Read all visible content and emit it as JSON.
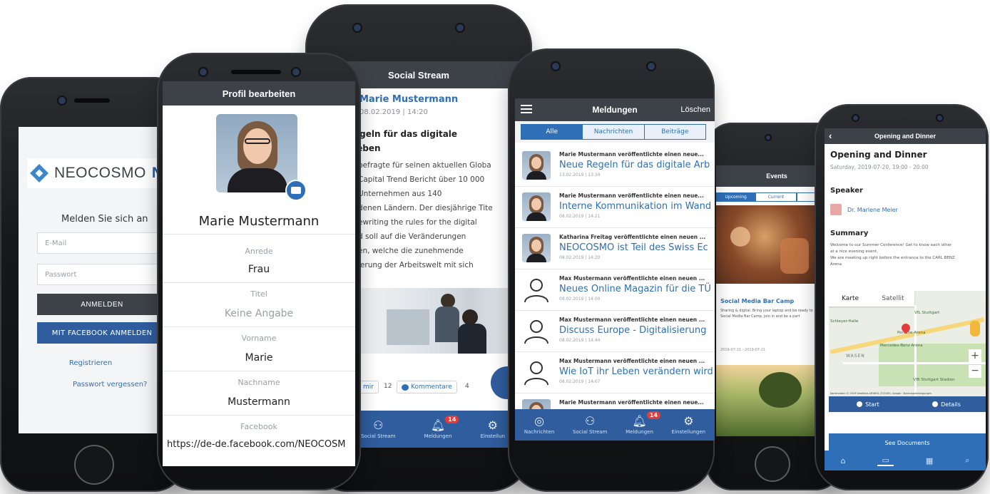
{
  "login": {
    "brand": "NEOCOSMO",
    "brand_cut": "N",
    "heading": "Melden Sie sich an",
    "email_placeholder": "E-Mail",
    "password_placeholder": "Passwort",
    "login_button": "ANMELDEN",
    "facebook_button": "MIT FACEBOOK ANMELDEN",
    "register_link": "Registrieren",
    "forgot_link": "Passwort vergessen?"
  },
  "profile": {
    "title": "Profil bearbeiten",
    "name": "Marie Mustermann",
    "fields": [
      {
        "label": "Anrede",
        "value": "Frau",
        "placeholder": false
      },
      {
        "label": "Titel",
        "value": "Keine Angabe",
        "placeholder": true
      },
      {
        "label": "Vorname",
        "value": "Marie",
        "placeholder": false
      },
      {
        "label": "Nachname",
        "value": "Mustermann",
        "placeholder": false
      },
      {
        "label": "Facebook",
        "value": "https://de-de.facebook.com/NEOCOSM",
        "placeholder": false
      }
    ]
  },
  "stream": {
    "title": "Social Stream",
    "author": "Marie Mustermann",
    "date": "08.02.2019 | 14:20",
    "headline_1": "egeln für das digitale",
    "headline_2": "leben",
    "body": [
      "befragte für seinen aktuellen Globa",
      "Capital Trend Bericht über 10 000",
      "Unternehmen aus 140",
      "denen Ländern. Der diesjährige Tite",
      "ewriting the rules for the digital",
      "d soll auf die Veränderungen",
      "en, welche die zunehmende",
      "ierung der Arbeitswelt mit sich"
    ],
    "like_label": "mir",
    "like_count": "12",
    "comment_label": "Kommentare",
    "comment_count": "4",
    "tabs": [
      {
        "label": "Social Stream",
        "icon": "people-icon"
      },
      {
        "label": "Meldungen",
        "icon": "bell-icon",
        "badge": "14"
      },
      {
        "label": "Einstellun",
        "icon": "gear-icon"
      }
    ]
  },
  "news": {
    "title": "Meldungen",
    "delete_label": "Löschen",
    "filters": [
      {
        "label": "Alle",
        "active": true
      },
      {
        "label": "Nachrichten",
        "active": false
      },
      {
        "label": "Beiträge",
        "active": false
      }
    ],
    "items": [
      {
        "meta": "Marie Mustermann veröffentlichte einen neue...",
        "title": "Neue Regeln für das digitale Arb",
        "date": "13.02.2019 | 13:34",
        "photo": true
      },
      {
        "meta": "Marie Mustermann veröffentlichte einen neue...",
        "title": "Interne Kommunikation im Wand",
        "date": "08.02.2019 | 14:21",
        "photo": true
      },
      {
        "meta": "Katharina Freitag veröffentlichte einen neuen ...",
        "title": "NEOCOSMO ist Teil des Swiss Ec",
        "date": "08.02.2019 | 14:20",
        "photo": true
      },
      {
        "meta": "Max Mustermann veröffentlichte einen neuen ...",
        "title": "Neues Online Magazin für die TÜ",
        "date": "08.02.2019 | 14:00",
        "photo": false
      },
      {
        "meta": "Max Mustermann veröffentlichte einen neuen ...",
        "title": "Discuss Europe - Digitalisierung",
        "date": "08.02.2019 | 14:44",
        "photo": false
      },
      {
        "meta": "Max Mustermann veröffentlichte einen neuen ...",
        "title": "Wie IoT ihr Leben verändern wird",
        "date": "08.02.2019 | 14:07",
        "photo": false
      },
      {
        "meta": "Marie Mustermann veröffentlichte einen neue...",
        "title": "",
        "date": "",
        "photo": true
      }
    ],
    "tabs": [
      {
        "label": "Nachrichten",
        "icon": "globe-icon"
      },
      {
        "label": "Social Stream",
        "icon": "people-icon"
      },
      {
        "label": "Meldungen",
        "icon": "bell-icon",
        "badge": "14"
      },
      {
        "label": "Einstellungen",
        "icon": "gear-icon"
      }
    ]
  },
  "events": {
    "title": "Events",
    "tabs": [
      "Upcoming",
      "Current",
      "La"
    ],
    "card_title": "Social Media Bar Camp",
    "card_text_1": "Sharing & digital. Bring your laptop and be ready to",
    "card_text_2": "Social Media Bar Camp, join in and be a part",
    "card_date": "2019-07-21 - 2019-07-21"
  },
  "detail": {
    "bar_title": "Opening and Dinner",
    "title": "Opening and Dinner",
    "datetime": "Saturday, 2019-07-20, 19:00 - 20:00",
    "speaker_heading": "Speaker",
    "speaker_name": "Dr. Marlene Meier",
    "summary_heading": "Summary",
    "summary_1": "Welcome to our Summer Conference! Get to know each other",
    "summary_2": "at a nice evening event.",
    "summary_3": "We are meeting up right before the entrance to the CARL BENZ",
    "summary_4": "Arena",
    "map_tab_1": "Karte",
    "map_tab_2": "Satellit",
    "map_labels": [
      "VfL Stuttgart",
      "Porsche-Arena",
      "Mercedes-Benz Arena",
      "WASEN",
      "VfB Stuttgart Stadion",
      "Schleyer-Halle"
    ],
    "map_attr": "Kartendaten © 2019 GeoBasis-DE/BKG (©2009), Google · Nutzungsbedingungen",
    "start_label": "Start",
    "details_label": "Details",
    "documents_label": "See Documents"
  }
}
